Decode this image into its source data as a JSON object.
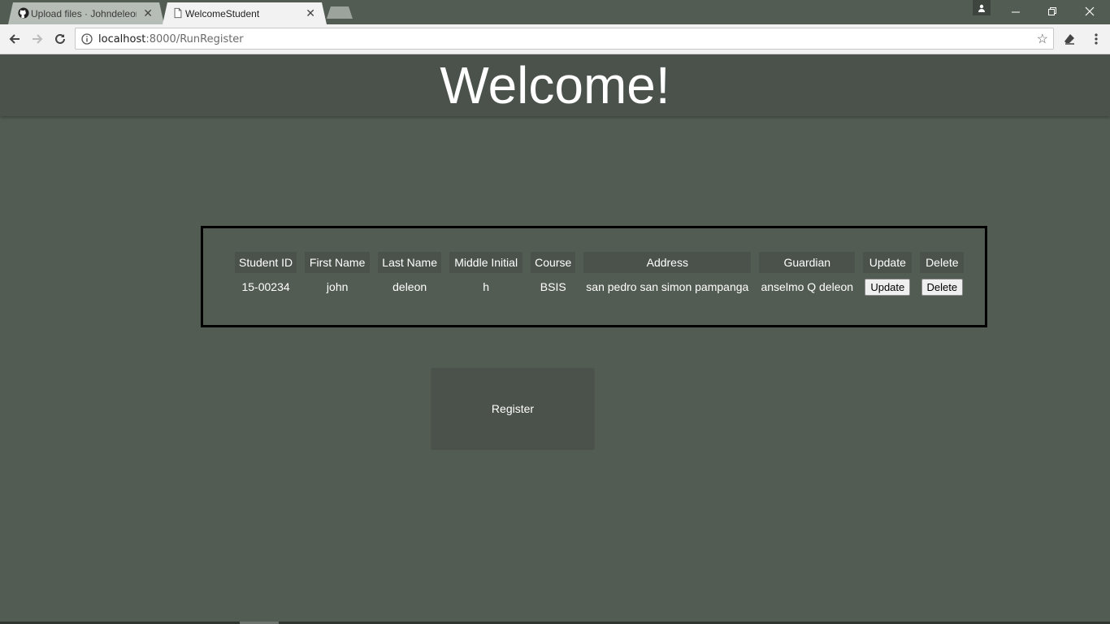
{
  "browser": {
    "tabs": [
      {
        "title": "Upload files · Johndeleon",
        "icon": "github-icon",
        "active": false
      },
      {
        "title": "WelcomeStudent",
        "icon": "page-icon",
        "active": true
      }
    ],
    "url_host": "localhost",
    "url_path": ":8000/RunRegister"
  },
  "page": {
    "heading": "Welcome!",
    "table": {
      "headers": [
        "Student ID",
        "First Name",
        "Last Name",
        "Middle Initial",
        "Course",
        "Address",
        "Guardian",
        "Update",
        "Delete"
      ],
      "rows": [
        {
          "student_id": "15-00234",
          "first_name": "john",
          "last_name": "deleon",
          "middle_initial": "h",
          "course": "BSIS",
          "address": "san pedro san simon pampanga",
          "guardian": "anselmo Q deleon",
          "update_label": "Update",
          "delete_label": "Delete"
        }
      ]
    },
    "register_label": "Register"
  },
  "colors": {
    "background": "#535c53",
    "panel": "#4b524b",
    "text": "#ffffff"
  }
}
